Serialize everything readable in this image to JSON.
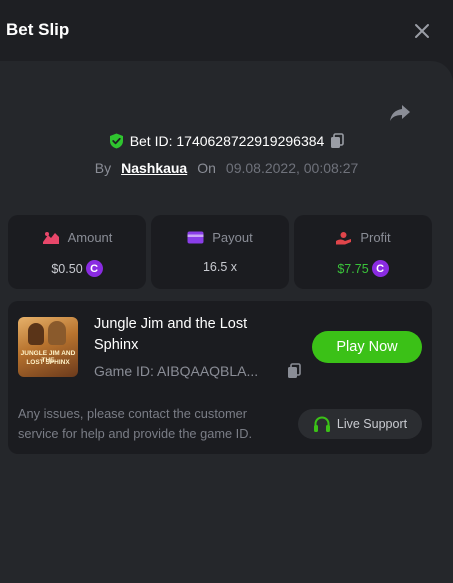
{
  "header": {
    "title": "Bet Slip"
  },
  "bet": {
    "id_label": "Bet ID: 1740628722919296384",
    "by_label": "By",
    "username": "Nashkaua",
    "on_label": "On",
    "date": "09.08.2022, 00:08:27"
  },
  "stats": [
    {
      "label": "Amount",
      "value": "$0.50",
      "icon": "money-bag-icon",
      "icon_color": "#e8476a",
      "has_coin": true
    },
    {
      "label": "Payout",
      "value": "16.5 x",
      "icon": "card-icon",
      "icon_color": "#8a3ee8",
      "has_coin": false
    },
    {
      "label": "Profit",
      "value": "$7.75",
      "icon": "hand-icon",
      "icon_color": "#e0454a",
      "has_coin": true,
      "value_color": "#3ac33a"
    }
  ],
  "coin": {
    "symbol": "C",
    "color": "#8a2be2"
  },
  "game": {
    "name": "Jungle Jim and the Lost Sphinx",
    "id_text": "Game ID: AIBQAAQBLA...",
    "thumb_line1": "JUNGLE JIM AND THE",
    "thumb_line2": "LOST SPHINX",
    "play_label": "Play Now"
  },
  "support": {
    "message": "Any issues, please contact the customer service for help and provide the game ID.",
    "button_label": "Live Support"
  },
  "colors": {
    "accent_green": "#3bc117",
    "background": "#1e1f23",
    "panel": "#25272b",
    "card": "#1b1c20"
  }
}
